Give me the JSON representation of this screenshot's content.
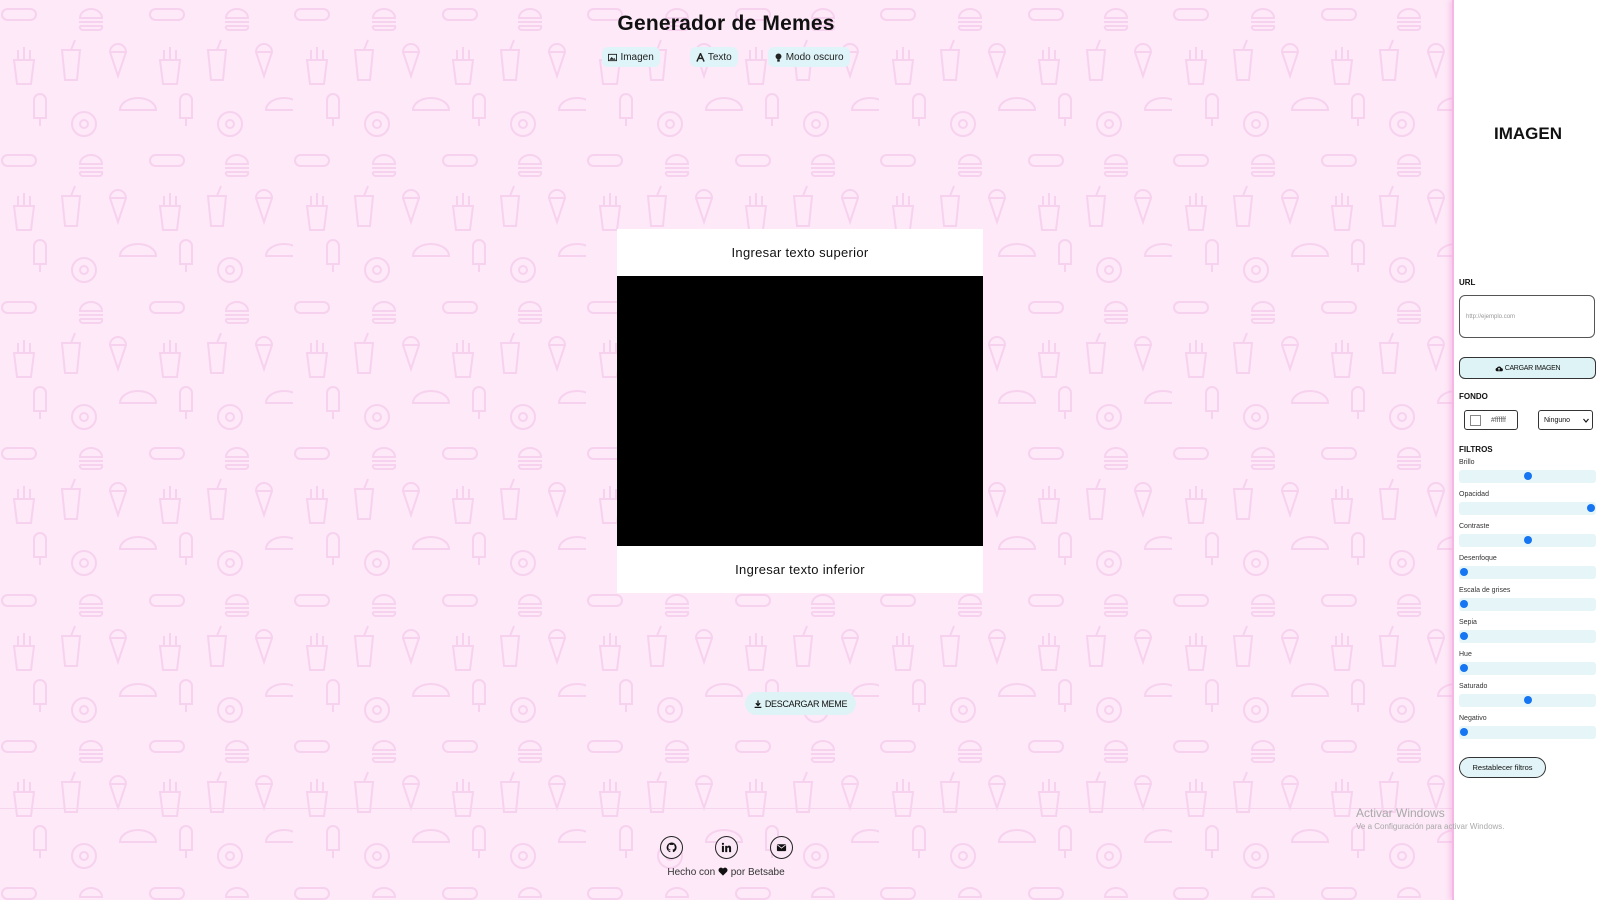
{
  "header": {
    "title": "Generador de Memes",
    "nav": [
      {
        "label": "Imagen",
        "icon": "image-icon"
      },
      {
        "label": "Texto",
        "icon": "text-icon"
      },
      {
        "label": "Modo oscuro",
        "icon": "lightbulb-icon"
      }
    ]
  },
  "meme": {
    "top_text": "Ingresar texto superior",
    "bottom_text": "Ingresar texto inferior",
    "image_color": "#000000"
  },
  "download": {
    "label": "DESCARGAR MEME",
    "icon": "download-icon"
  },
  "footer": {
    "social": [
      "github-icon",
      "linkedin-icon",
      "envelope-icon"
    ],
    "made_prefix": "Hecho con",
    "made_suffix": "por Betsabe"
  },
  "watermark": {
    "line1": "Activar Windows",
    "line2": "Ve a Configuración para activar Windows."
  },
  "panel": {
    "title": "IMAGEN",
    "url_label": "URL",
    "url_placeholder": "http://ejemplo.com",
    "load_button": "CARGAR IMAGEN",
    "background_label": "FONDO",
    "background_color": "#ffffff",
    "blend_mode": "Ninguno",
    "filters_label": "FILTROS",
    "filters": [
      {
        "label": "Brillo",
        "value": 0.5
      },
      {
        "label": "Opacidad",
        "value": 1
      },
      {
        "label": "Contraste",
        "value": 0.5
      },
      {
        "label": "Desenfoque",
        "value": 0
      },
      {
        "label": "Escala de grises",
        "value": 0
      },
      {
        "label": "Sepia",
        "value": 0
      },
      {
        "label": "Hue",
        "value": 0
      },
      {
        "label": "Saturado",
        "value": 0.5
      },
      {
        "label": "Negativo",
        "value": 0
      }
    ],
    "reset_button": "Restablecer filtros"
  },
  "colors": {
    "background": "#fde9f8",
    "accent": "#dff4f8",
    "slider_thumb": "#1675f2",
    "panel_border": "#f4b7e6"
  }
}
